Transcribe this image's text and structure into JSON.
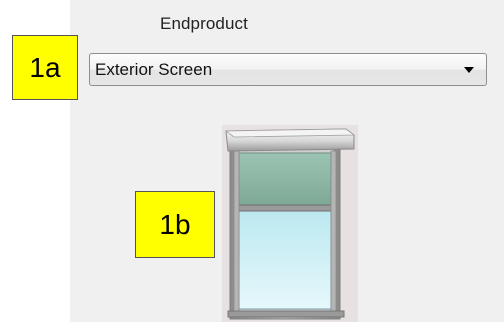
{
  "endproduct": {
    "label": "Endproduct",
    "selected_value": "Exterior Screen",
    "arrow_icon": "chevron-down-icon"
  },
  "callouts": {
    "first": "1a",
    "second": "1b"
  },
  "colors": {
    "callout_background": "#ffff00",
    "screen_fabric": "#8fb9a6",
    "glass": "#bfeaf2",
    "frame": "#a3a3a3"
  },
  "product_image": {
    "icon": "window-with-exterior-screen-icon"
  }
}
